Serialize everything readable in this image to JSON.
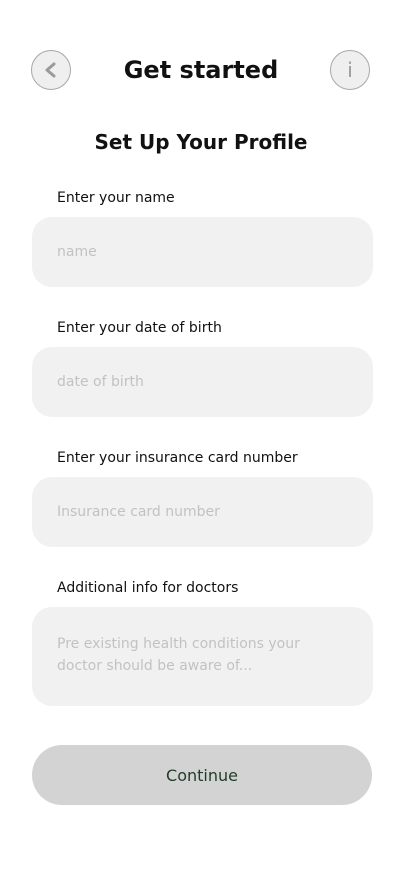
{
  "header": {
    "title": "Get started",
    "back_icon": "chevron-left-icon",
    "info_icon": "info-icon",
    "info_glyph": "i"
  },
  "subtitle": "Set Up Your Profile",
  "form": {
    "name": {
      "label": "Enter your name",
      "placeholder": "name",
      "value": ""
    },
    "dob": {
      "label": "Enter your date of birth",
      "placeholder": "date of birth",
      "value": ""
    },
    "insurance": {
      "label": "Enter your insurance card number",
      "placeholder": "Insurance card number",
      "value": ""
    },
    "additional": {
      "label": "Additional info for doctors",
      "placeholder": "Pre existing health conditions your doctor should be aware of...",
      "value": ""
    }
  },
  "continue_label": "Continue",
  "colors": {
    "field_bg": "#f1f1f1",
    "button_bg": "#d3d3d3",
    "button_text": "#1f3d26",
    "placeholder": "#c2c2c2"
  }
}
